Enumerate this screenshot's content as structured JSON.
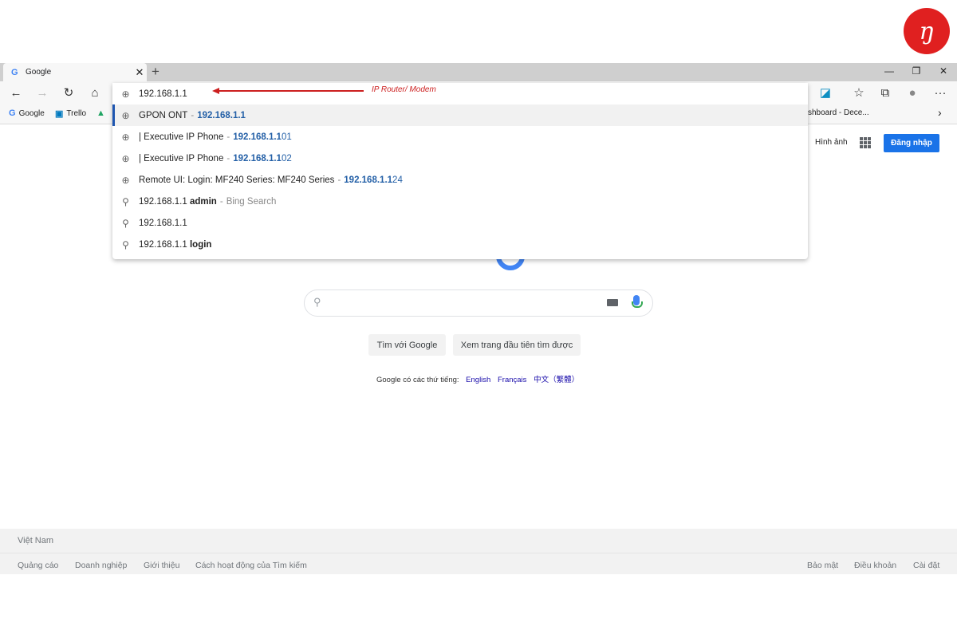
{
  "brand": {
    "logo_text": "ŋ",
    "accent": "#e02020"
  },
  "tab": {
    "favicon": "G",
    "title": "Google",
    "close": "✕",
    "new": "+"
  },
  "window_controls": {
    "minimize": "—",
    "restore": "❐",
    "close": "✕"
  },
  "toolbar": {
    "back": "←",
    "forward": "→",
    "reload": "↻",
    "home": "⌂",
    "more": "···"
  },
  "bookmarks": [
    {
      "icon": "G",
      "label": "Google"
    },
    {
      "icon": "▣",
      "label": "Trello"
    },
    {
      "icon": "▲",
      "label": ""
    }
  ],
  "bookmarks_right": {
    "label": "shboard - Dece...",
    "chevron": "›"
  },
  "omnibox": {
    "query": "192.168.1.1",
    "annotation": "IP Router/ Modem",
    "suggestions": [
      {
        "icon": "globe-icon",
        "title": "GPON ONT",
        "sep": "-",
        "url_match": "192.168.1.1",
        "url_rest": ""
      },
      {
        "icon": "globe-icon",
        "title": "| Executive IP Phone",
        "sep": "-",
        "url_match": "192.168.1.1",
        "url_rest": "01"
      },
      {
        "icon": "globe-icon",
        "title": "| Executive IP Phone",
        "sep": "-",
        "url_match": "192.168.1.1",
        "url_rest": "02"
      },
      {
        "icon": "globe-icon",
        "title": "Remote UI: Login: MF240 Series: MF240 Series",
        "sep": "-",
        "url_match": "192.168.1.1",
        "url_rest": "24"
      },
      {
        "icon": "search-icon",
        "prefix": "192.168.1.1",
        "bold": "admin",
        "sep": "-",
        "muted": "Bing Search"
      },
      {
        "icon": "search-icon",
        "prefix": "192.168.1.1",
        "bold": "",
        "sep": "",
        "muted": ""
      },
      {
        "icon": "search-icon",
        "prefix": "192.168.1.1",
        "bold": "login",
        "sep": "",
        "muted": ""
      }
    ]
  },
  "google": {
    "images_link": "Hình ảnh",
    "signin": "Đăng nhập",
    "btn_search": "Tìm với Google",
    "btn_lucky": "Xem trang đầu tiên tìm được",
    "lang_prefix": "Google có các thứ tiếng:",
    "lang_en": "English",
    "lang_fr": "Français",
    "lang_zh": "中文（繁體）"
  },
  "footer": {
    "country": "Việt Nam",
    "left": [
      "Quảng cáo",
      "Doanh nghiệp",
      "Giới thiệu",
      "Cách hoạt động của Tìm kiếm"
    ],
    "right": [
      "Bảo mật",
      "Điều khoản",
      "Cài đặt"
    ]
  }
}
